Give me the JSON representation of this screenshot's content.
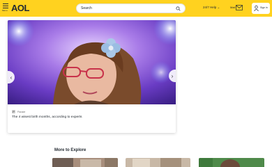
{
  "header": {
    "menu_label": "Menu",
    "logo": "AOL",
    "search_placeholder": "Search",
    "help_label": "24/7 Help",
    "mail_label": "Mail",
    "signin_label": "Sign in"
  },
  "main": {
    "hero": {
      "source_name": "Parade",
      "headline": "The 4 wisest birth months, according to experts"
    },
    "explore_title": "More to Explore"
  },
  "colors": {
    "header_bg": "#ffd21f",
    "text": "#232a31"
  }
}
